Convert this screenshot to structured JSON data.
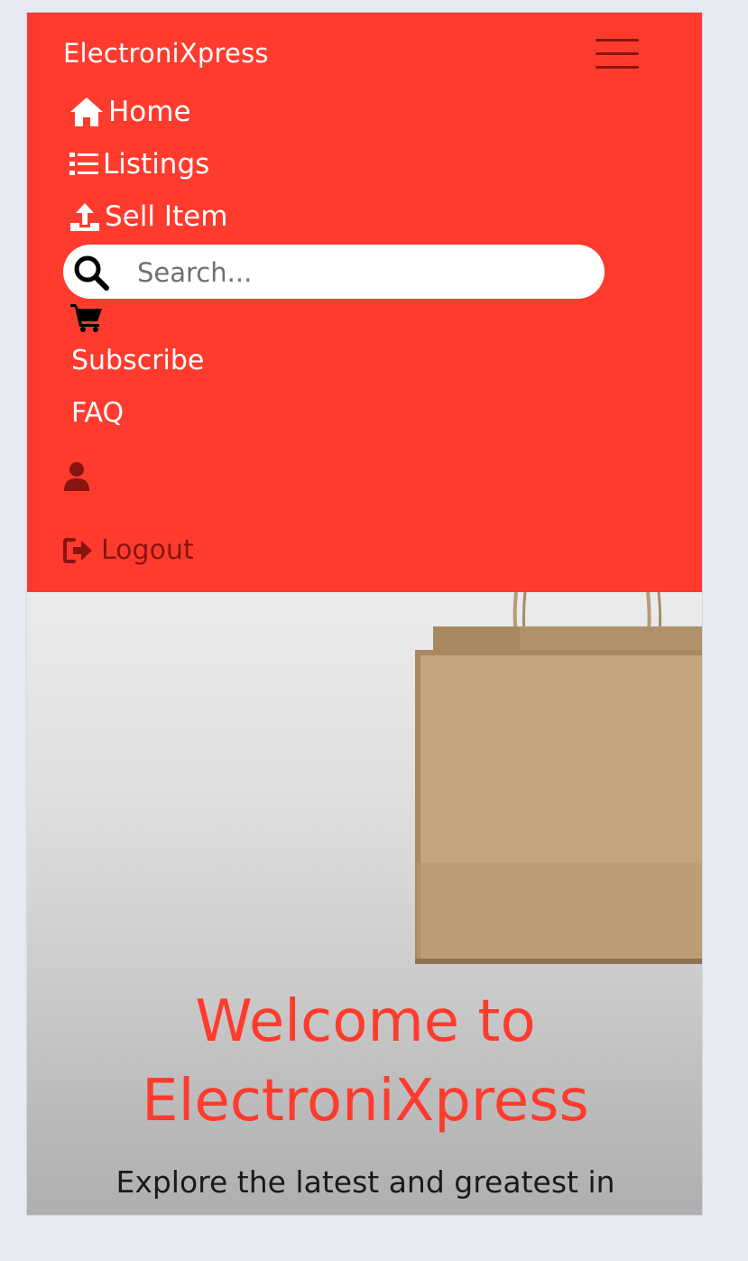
{
  "navbar": {
    "brand": "ElectroniXpress",
    "links": {
      "home": "Home",
      "listings": "Listings",
      "sell": "Sell Item",
      "subscribe": "Subscribe",
      "faq": "FAQ",
      "logout": "Logout"
    },
    "search": {
      "placeholder": "Search...",
      "value": ""
    },
    "icons": [
      "hamburger-icon",
      "home-icon",
      "list-icon",
      "upload-icon",
      "search-icon",
      "cart-icon",
      "user-icon",
      "logout-icon"
    ]
  },
  "hero": {
    "title_line1": "Welcome to",
    "title_line2": "ElectroniXpress",
    "subtitle": "Explore the latest and greatest in"
  },
  "colors": {
    "brand_red": "#ff3b2e",
    "dark_red": "#8a1410",
    "page_bg": "#e6e8f2"
  }
}
